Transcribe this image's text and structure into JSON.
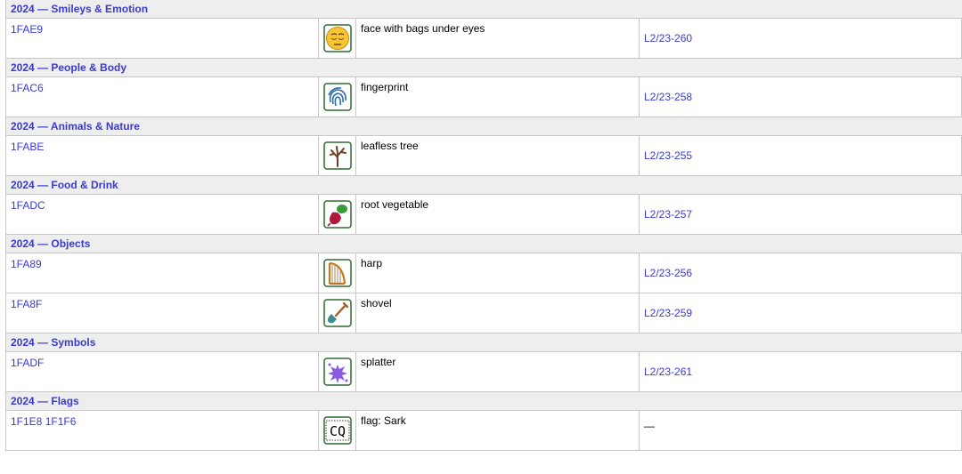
{
  "groups": [
    {
      "header": "2024 — Smileys & Emotion",
      "rows": [
        {
          "code": "1FAE9",
          "icon": "face-with-bags-under-eyes-icon",
          "name": "face with bags under eyes",
          "ref": "L2/23-260"
        }
      ]
    },
    {
      "header": "2024 — People & Body",
      "rows": [
        {
          "code": "1FAC6",
          "icon": "fingerprint-icon",
          "name": "fingerprint",
          "ref": "L2/23-258"
        }
      ]
    },
    {
      "header": "2024 — Animals & Nature",
      "rows": [
        {
          "code": "1FABE",
          "icon": "leafless-tree-icon",
          "name": "leafless tree",
          "ref": "L2/23-255"
        }
      ]
    },
    {
      "header": "2024 — Food & Drink",
      "rows": [
        {
          "code": "1FADC",
          "icon": "root-vegetable-icon",
          "name": "root vegetable",
          "ref": "L2/23-257"
        }
      ]
    },
    {
      "header": "2024 — Objects",
      "rows": [
        {
          "code": "1FA89",
          "icon": "harp-icon",
          "name": "harp",
          "ref": "L2/23-256"
        },
        {
          "code": "1FA8F",
          "icon": "shovel-icon",
          "name": "shovel",
          "ref": "L2/23-259"
        }
      ]
    },
    {
      "header": "2024 — Symbols",
      "rows": [
        {
          "code": "1FADF",
          "icon": "splatter-icon",
          "name": "splatter",
          "ref": "L2/23-261"
        }
      ]
    },
    {
      "header": "2024 — Flags",
      "rows": [
        {
          "code": "1F1E8 1F1F6",
          "icon": "flag-sark-icon",
          "name": "flag: Sark",
          "ref": "—",
          "flag_letters": "CQ"
        }
      ]
    }
  ],
  "colors": {
    "link": "#3a3ad0",
    "header_bg": "#eeeeee",
    "border": "#c8c8c8",
    "icon_frame": "#2f6b2f"
  }
}
